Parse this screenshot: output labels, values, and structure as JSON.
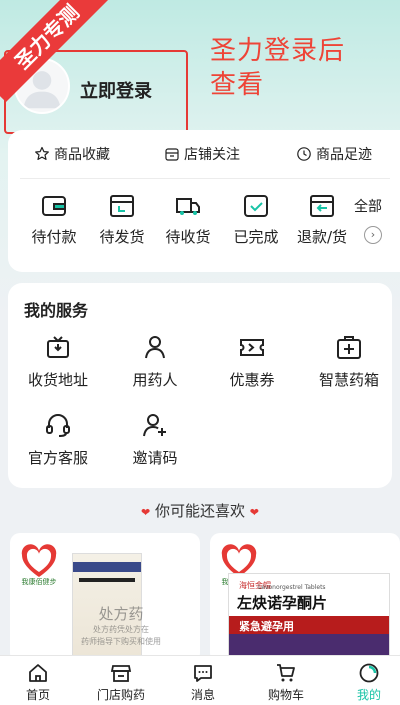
{
  "watermark": "圣力专测",
  "login": {
    "label": "立即登录",
    "hint": "圣力登录后查看"
  },
  "quick_links": [
    {
      "label": "商品收藏",
      "icon": "star-icon"
    },
    {
      "label": "店铺关注",
      "icon": "store-icon"
    },
    {
      "label": "商品足迹",
      "icon": "clock-icon"
    }
  ],
  "orders": [
    {
      "label": "待付款",
      "icon": "wallet-icon"
    },
    {
      "label": "待发货",
      "icon": "package-icon"
    },
    {
      "label": "待收货",
      "icon": "truck-icon"
    },
    {
      "label": "已完成",
      "icon": "check-box-icon"
    },
    {
      "label": "退款/货",
      "icon": "return-icon"
    }
  ],
  "orders_all": "全部",
  "services": {
    "title": "我的服务",
    "items": [
      {
        "label": "收货地址",
        "icon": "address-box-icon"
      },
      {
        "label": "用药人",
        "icon": "user-icon"
      },
      {
        "label": "优惠券",
        "icon": "coupon-icon"
      },
      {
        "label": "智慧药箱",
        "icon": "medicine-box-icon"
      },
      {
        "label": "官方客服",
        "icon": "headset-icon"
      },
      {
        "label": "邀请码",
        "icon": "add-user-icon"
      }
    ]
  },
  "recommend": {
    "title": "你可能还喜欢",
    "products": [
      {
        "brand_text": "我康佰健步",
        "rx_label": "处方药",
        "rx_note_1": "处方药凭处方在",
        "rx_note_2": "药师指导下购买和使用"
      },
      {
        "brand_text": "我康佰健步",
        "name": "左炔诺孕酮片",
        "english": "Levonorgestrel Tablets",
        "band": "紧急避孕用",
        "tag": "海恒金帽"
      }
    ]
  },
  "tabbar": [
    {
      "label": "首页",
      "icon": "home-icon"
    },
    {
      "label": "门店购药",
      "icon": "shop-icon"
    },
    {
      "label": "消息",
      "icon": "message-icon"
    },
    {
      "label": "购物车",
      "icon": "cart-icon"
    },
    {
      "label": "我的",
      "icon": "profile-icon"
    }
  ],
  "colors": {
    "accent": "#18c3a6",
    "alert": "#e53935"
  }
}
